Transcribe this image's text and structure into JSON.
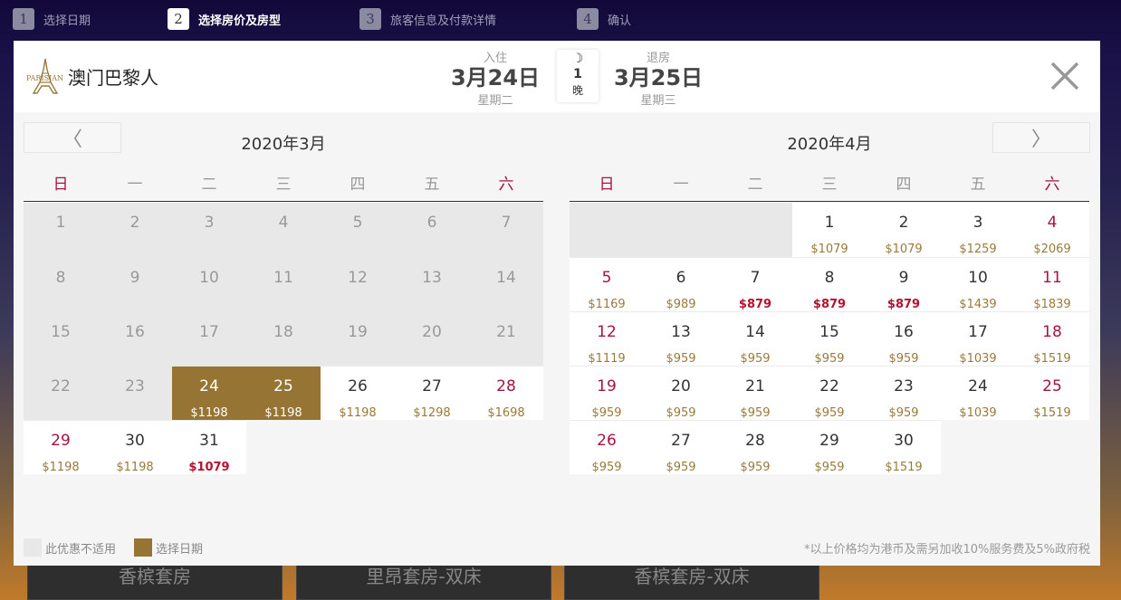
{
  "steps": [
    {
      "num": "1",
      "label": "选择日期"
    },
    {
      "num": "2",
      "label": "选择房价及房型"
    },
    {
      "num": "3",
      "label": "旅客信息及付款详情"
    },
    {
      "num": "4",
      "label": "确认"
    }
  ],
  "header": {
    "logo_text": "澳门巴黎人",
    "checkin": {
      "label": "入住",
      "date": "3月24日",
      "weekday": "星期二"
    },
    "nights": {
      "count": "1",
      "label": "晚"
    },
    "checkout": {
      "label": "退房",
      "date": "3月25日",
      "weekday": "星期三"
    }
  },
  "nav": {
    "prev": "〈",
    "next": "〉"
  },
  "weekdays": [
    "日",
    "一",
    "二",
    "三",
    "四",
    "五",
    "六"
  ],
  "march": {
    "title": "2020年3月",
    "days": [
      {
        "d": "1",
        "p": "",
        "s": "na"
      },
      {
        "d": "2",
        "p": "",
        "s": "na"
      },
      {
        "d": "3",
        "p": "",
        "s": "na"
      },
      {
        "d": "4",
        "p": "",
        "s": "na"
      },
      {
        "d": "5",
        "p": "",
        "s": "na"
      },
      {
        "d": "6",
        "p": "",
        "s": "na"
      },
      {
        "d": "7",
        "p": "",
        "s": "na"
      },
      {
        "d": "8",
        "p": "",
        "s": "na"
      },
      {
        "d": "9",
        "p": "",
        "s": "na"
      },
      {
        "d": "10",
        "p": "",
        "s": "na"
      },
      {
        "d": "11",
        "p": "",
        "s": "na"
      },
      {
        "d": "12",
        "p": "",
        "s": "na"
      },
      {
        "d": "13",
        "p": "",
        "s": "na"
      },
      {
        "d": "14",
        "p": "",
        "s": "na"
      },
      {
        "d": "15",
        "p": "",
        "s": "na"
      },
      {
        "d": "16",
        "p": "",
        "s": "na"
      },
      {
        "d": "17",
        "p": "",
        "s": "na"
      },
      {
        "d": "18",
        "p": "",
        "s": "na"
      },
      {
        "d": "19",
        "p": "",
        "s": "na"
      },
      {
        "d": "20",
        "p": "",
        "s": "na"
      },
      {
        "d": "21",
        "p": "",
        "s": "na"
      },
      {
        "d": "22",
        "p": "",
        "s": "na"
      },
      {
        "d": "23",
        "p": "",
        "s": "na"
      },
      {
        "d": "24",
        "p": "$1198",
        "s": "sel"
      },
      {
        "d": "25",
        "p": "$1198",
        "s": "sel"
      },
      {
        "d": "26",
        "p": "$1198",
        "s": "av"
      },
      {
        "d": "27",
        "p": "$1298",
        "s": "av"
      },
      {
        "d": "28",
        "p": "$1698",
        "s": "av"
      },
      {
        "d": "29",
        "p": "$1198",
        "s": "av"
      },
      {
        "d": "30",
        "p": "$1198",
        "s": "av"
      },
      {
        "d": "31",
        "p": "$1079",
        "s": "low"
      }
    ]
  },
  "april": {
    "title": "2020年4月",
    "days": [
      {
        "d": "1",
        "p": "$1079",
        "s": "av"
      },
      {
        "d": "2",
        "p": "$1079",
        "s": "av"
      },
      {
        "d": "3",
        "p": "$1259",
        "s": "av"
      },
      {
        "d": "4",
        "p": "$2069",
        "s": "av"
      },
      {
        "d": "5",
        "p": "$1169",
        "s": "av"
      },
      {
        "d": "6",
        "p": "$989",
        "s": "av"
      },
      {
        "d": "7",
        "p": "$879",
        "s": "low"
      },
      {
        "d": "8",
        "p": "$879",
        "s": "low"
      },
      {
        "d": "9",
        "p": "$879",
        "s": "low"
      },
      {
        "d": "10",
        "p": "$1439",
        "s": "av"
      },
      {
        "d": "11",
        "p": "$1839",
        "s": "av"
      },
      {
        "d": "12",
        "p": "$1119",
        "s": "av"
      },
      {
        "d": "13",
        "p": "$959",
        "s": "av"
      },
      {
        "d": "14",
        "p": "$959",
        "s": "av"
      },
      {
        "d": "15",
        "p": "$959",
        "s": "av"
      },
      {
        "d": "16",
        "p": "$959",
        "s": "av"
      },
      {
        "d": "17",
        "p": "$1039",
        "s": "av"
      },
      {
        "d": "18",
        "p": "$1519",
        "s": "av"
      },
      {
        "d": "19",
        "p": "$959",
        "s": "av"
      },
      {
        "d": "20",
        "p": "$959",
        "s": "av"
      },
      {
        "d": "21",
        "p": "$959",
        "s": "av"
      },
      {
        "d": "22",
        "p": "$959",
        "s": "av"
      },
      {
        "d": "23",
        "p": "$959",
        "s": "av"
      },
      {
        "d": "24",
        "p": "$1039",
        "s": "av"
      },
      {
        "d": "25",
        "p": "$1519",
        "s": "av"
      },
      {
        "d": "26",
        "p": "$959",
        "s": "av"
      },
      {
        "d": "27",
        "p": "$959",
        "s": "av"
      },
      {
        "d": "28",
        "p": "$959",
        "s": "av"
      },
      {
        "d": "29",
        "p": "$959",
        "s": "av"
      },
      {
        "d": "30",
        "p": "$1519",
        "s": "av"
      }
    ]
  },
  "legend": {
    "unavailable": "此优惠不适用",
    "selected": "选择日期"
  },
  "note": "*以上价格均为港币及需另加收10%服务费及5%政府税",
  "rooms": [
    "香槟套房",
    "里昂套房-双床",
    "香槟套房-双床"
  ],
  "colors": {
    "selected": "#967433",
    "weekend": "#a8123f",
    "price": "#9a7a3a",
    "low_price": "#b5112f",
    "unavailable": "#e8e8e8"
  }
}
